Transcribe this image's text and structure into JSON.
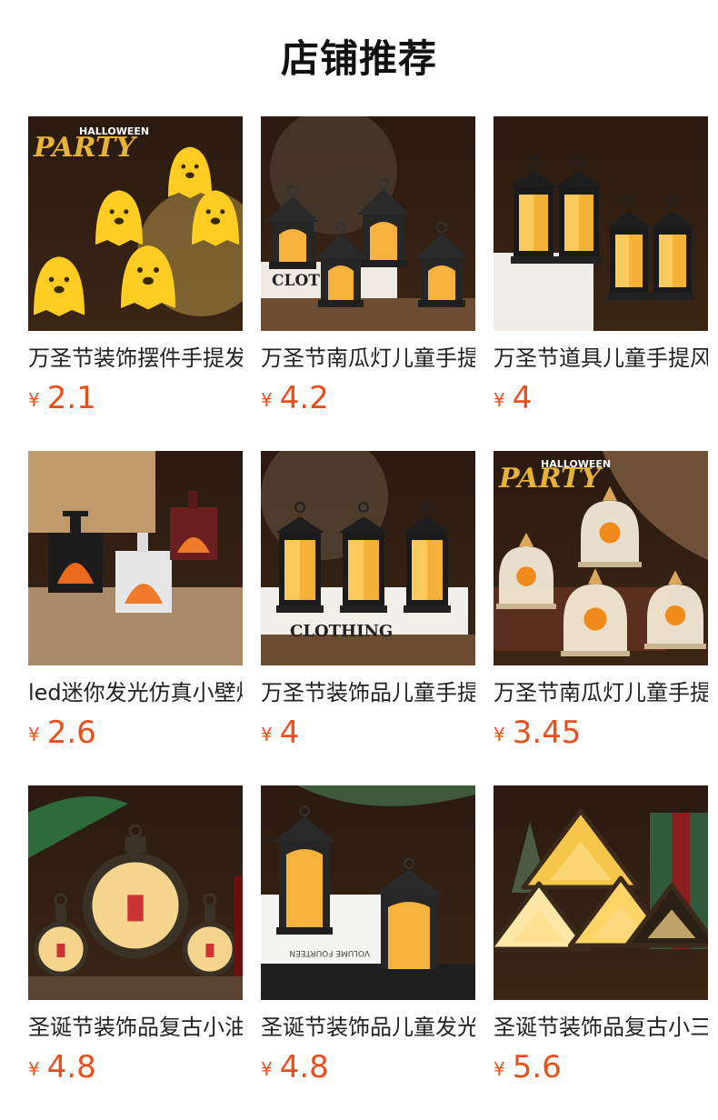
{
  "header": {
    "title": "店铺推荐"
  },
  "currency_symbol": "¥",
  "products": [
    {
      "name": "万圣节装饰摆件手提发光幽灵灯",
      "price": "2.1",
      "image_icon": "ghost-lights-icon",
      "caption": ""
    },
    {
      "name": "万圣节南瓜灯儿童手提灯笼",
      "price": "4.2",
      "image_icon": "house-lanterns-icon",
      "caption": "CLOT"
    },
    {
      "name": "万圣节道具儿童手提风灯",
      "price": "4",
      "image_icon": "lanterns-icon",
      "caption": ""
    },
    {
      "name": "led迷你发光仿真小壁炉",
      "price": "2.6",
      "image_icon": "fireplace-icon",
      "caption": ""
    },
    {
      "name": "万圣节装饰品儿童手提风灯",
      "price": "4",
      "image_icon": "lanterns-icon",
      "caption": "CLOTHING"
    },
    {
      "name": "万圣节南瓜灯儿童手提夜灯",
      "price": "3.45",
      "image_icon": "dome-lights-icon",
      "caption": ""
    },
    {
      "name": "圣诞节装饰品复古小油灯",
      "price": "4.8",
      "image_icon": "round-lanterns-icon",
      "caption": ""
    },
    {
      "name": "圣诞节装饰品儿童发光小屋",
      "price": "4.8",
      "image_icon": "house-lanterns-icon",
      "caption": ""
    },
    {
      "name": "圣诞节装饰品复古小三角灯",
      "price": "5.6",
      "image_icon": "triangle-lights-icon",
      "caption": ""
    }
  ]
}
